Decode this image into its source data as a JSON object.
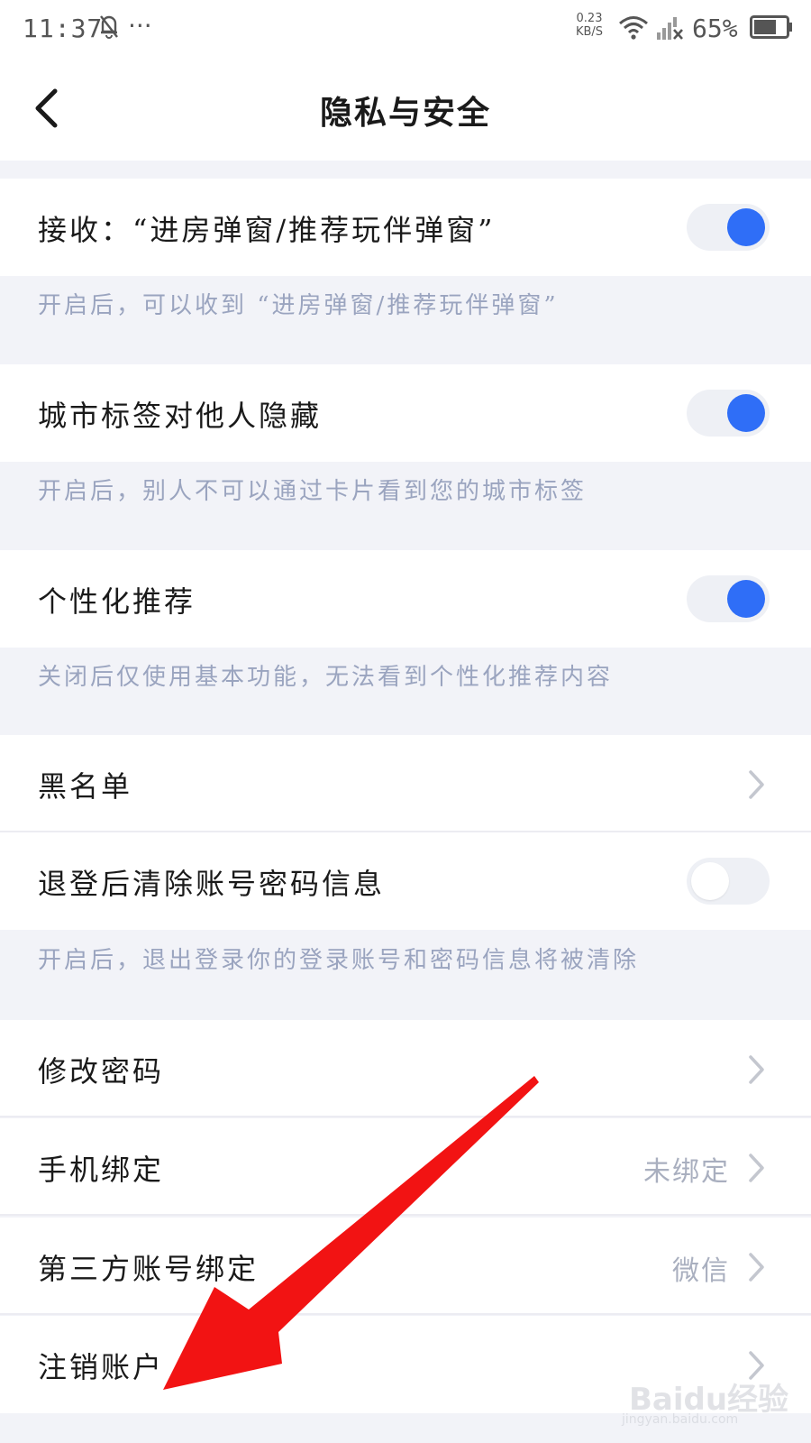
{
  "status": {
    "time": "11:37",
    "more": "···",
    "net_speed_value": "0.23",
    "net_speed_unit": "KB/S",
    "battery": "65%",
    "icons": [
      "mute-bell-icon",
      "wifi-icon",
      "signal-no-service-icon",
      "battery-icon"
    ]
  },
  "header": {
    "title": "隐私与安全"
  },
  "settings": [
    {
      "label": "接收：“进房弹窗/推荐玩伴弹窗”",
      "control": "toggle",
      "on": true,
      "desc": "开启后，可以收到 “进房弹窗/推荐玩伴弹窗”"
    },
    {
      "label": "城市标签对他人隐藏",
      "control": "toggle",
      "on": true,
      "desc": "开启后，别人不可以通过卡片看到您的城市标签"
    },
    {
      "label": "个性化推荐",
      "control": "toggle",
      "on": true,
      "desc": "关闭后仅使用基本功能，无法看到个性化推荐内容"
    },
    {
      "label": "黑名单",
      "control": "chevron"
    },
    {
      "label": "退登后清除账号密码信息",
      "control": "toggle",
      "on": false,
      "desc": "开启后，退出登录你的登录账号和密码信息将被清除"
    },
    {
      "label": "修改密码",
      "control": "chevron"
    },
    {
      "label": "手机绑定",
      "control": "chevron",
      "value": "未绑定"
    },
    {
      "label": "第三方账号绑定",
      "control": "chevron",
      "value": "微信"
    },
    {
      "label": "注销账户",
      "control": "chevron"
    }
  ],
  "colors": {
    "accent": "#2f6ef7",
    "annotation_arrow": "#f21313",
    "background": "#f2f3f8",
    "desc_text": "#9aa4bf"
  },
  "watermark": {
    "text": "Baidu经验",
    "sub": "jingyan.baidu.com"
  }
}
